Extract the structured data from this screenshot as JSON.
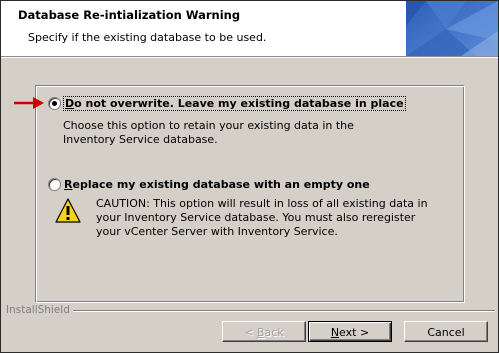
{
  "header": {
    "title": "Database Re-intialization  Warning",
    "subtitle": "Specify if the existing database to be used."
  },
  "options": [
    {
      "label": "Do not overwrite. Leave my existing database in place",
      "label_mnemonic": "D",
      "label_rest": "o not overwrite. Leave my existing database in place",
      "checked": true,
      "description": "Choose this option to retain your existing data in the Inventory Service database."
    },
    {
      "label": "Replace my existing database with an empty one",
      "label_mnemonic": "R",
      "label_rest": "eplace my existing database with an empty one",
      "checked": false,
      "description": "CAUTION: This option will result in loss of all existing data in your Inventory Service database. You must also reregister your vCenter Server with Inventory Service."
    }
  ],
  "footer": {
    "brand": "InstallShield"
  },
  "buttons": {
    "back": {
      "prefix": "< ",
      "mnemonic": "B",
      "rest": "ack",
      "enabled": false
    },
    "next": {
      "mnemonic": "N",
      "rest": "ext >",
      "enabled": true
    },
    "cancel": {
      "label": "Cancel",
      "enabled": true
    }
  },
  "colors": {
    "arrow": "#cc0000",
    "banner_blue": "#3f6fc0",
    "warning_yellow": "#f7d417"
  },
  "icons": [
    "red-arrow-icon",
    "warning-icon"
  ]
}
